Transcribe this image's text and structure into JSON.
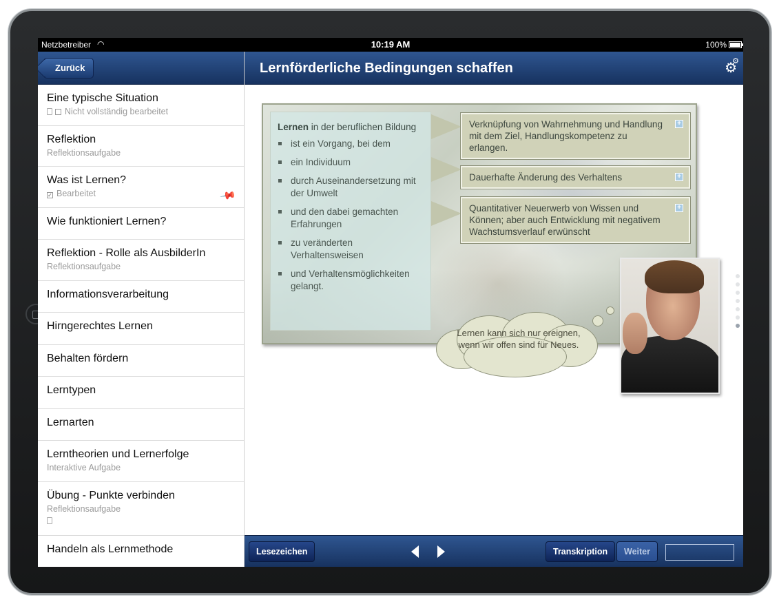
{
  "status": {
    "carrier": "Netzbetreiber",
    "time": "10:19 AM",
    "battery": "100%"
  },
  "sidebar": {
    "back_label": "Zurück",
    "items": [
      {
        "title": "Eine typische Situation",
        "subtitle": "Nicht vollständig bearbeitet"
      },
      {
        "title": "Reflektion",
        "subtitle": "Reflektionsaufgabe"
      },
      {
        "title": "Was ist Lernen?",
        "subtitle": "Bearbeitet"
      },
      {
        "title": "Wie funktioniert Lernen?"
      },
      {
        "title": "Reflektion - Rolle als AusbilderIn",
        "subtitle": "Reflektionsaufgabe"
      },
      {
        "title": "Informationsverarbeitung"
      },
      {
        "title": "Hirngerechtes Lernen"
      },
      {
        "title": "Behalten fördern"
      },
      {
        "title": "Lerntypen"
      },
      {
        "title": "Lernarten"
      },
      {
        "title": "Lerntheorien und Lernerfolge",
        "subtitle": "Interaktive Aufgabe"
      },
      {
        "title": "Übung - Punkte verbinden",
        "subtitle": "Reflektionsaufgabe"
      },
      {
        "title": "Handeln als Lernmethode"
      }
    ]
  },
  "header": {
    "title": "Lernförderliche Bedingungen schaffen"
  },
  "content": {
    "definition": {
      "term": "Lernen",
      "heading_rest": " in der beruflichen Bildung",
      "bullets": [
        "ist ein Vorgang, bei dem",
        "ein Individuum",
        "durch Auseinandersetzung mit der Umwelt",
        "und den dabei gemachten Erfahrungen",
        "zu veränderten Verhaltensweisen",
        "und Verhaltensmöglichkeiten gelangt."
      ]
    },
    "info_boxes": [
      "Verknüpfung von Wahrnehmung und Handlung mit dem Ziel, Handlungskompetenz zu erlangen.",
      "Dauerhafte Änderung des Verhaltens",
      "Quantitativer Neuerwerb von Wissen und Können; aber auch Entwicklung mit negativem Wachstumsverlauf erwünscht"
    ],
    "thought": "Lernen kann sich nur ereignen, wenn wir offen sind für Neues."
  },
  "toolbar": {
    "bookmark": "Lesezeichen",
    "transcript": "Transkription",
    "next": "Weiter"
  }
}
